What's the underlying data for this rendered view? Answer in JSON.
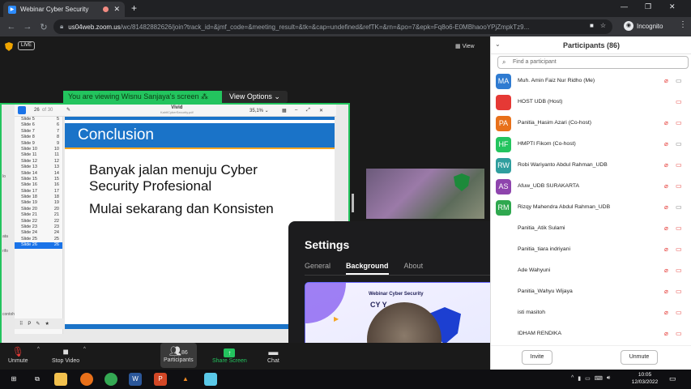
{
  "browser": {
    "tab_title": "Webinar Cyber Security",
    "url_host": "us04web.zoom.us",
    "url_path": "/wc/81482882626/join?track_id=&jmf_code=&meeting_result=&tk=&cap=undefined&refTK=&rn=&po=7&epk=Fq8o6-E0MBhaooYPjZmpkTz9...",
    "incognito_label": "Incognito"
  },
  "meeting": {
    "live_badge": "LIVE",
    "view_label": "View",
    "viewing_banner": "You are viewing Wisnu Sanjaya's screen",
    "view_options": "View Options"
  },
  "viewer": {
    "page_current": "26",
    "page_total": "of 30",
    "doc_title": "Vivid",
    "doc_subtitle": "KahfiCyberSecurity.pdf",
    "zoom_value": "35,1%",
    "slides": [
      {
        "label": "Slide 5",
        "num": "5"
      },
      {
        "label": "Slide 6",
        "num": "6"
      },
      {
        "label": "Slide 7",
        "num": "7"
      },
      {
        "label": "Slide 8",
        "num": "8"
      },
      {
        "label": "Slide 9",
        "num": "9"
      },
      {
        "label": "Slide 10",
        "num": "10"
      },
      {
        "label": "Slide 11",
        "num": "11"
      },
      {
        "label": "Slide 12",
        "num": "12"
      },
      {
        "label": "Slide 13",
        "num": "13"
      },
      {
        "label": "Slide 14",
        "num": "14"
      },
      {
        "label": "Slide 15",
        "num": "15"
      },
      {
        "label": "Slide 16",
        "num": "16"
      },
      {
        "label": "Slide 17",
        "num": "17"
      },
      {
        "label": "Slide 18",
        "num": "18"
      },
      {
        "label": "Slide 19",
        "num": "19"
      },
      {
        "label": "Slide 20",
        "num": "20"
      },
      {
        "label": "Slide 21",
        "num": "21"
      },
      {
        "label": "Slide 22",
        "num": "22"
      },
      {
        "label": "Slide 23",
        "num": "23"
      },
      {
        "label": "Slide 24",
        "num": "24"
      },
      {
        "label": "Slide 25",
        "num": "25"
      },
      {
        "label": "Slide 26",
        "num": "26"
      }
    ],
    "side_labels": [
      "lo",
      "ata",
      "rifo",
      "contoh"
    ],
    "bottom_names": [
      "Participants",
      "Portfolio",
      "HKCTOD"
    ]
  },
  "slide": {
    "heading": "Conclusion",
    "line1": "Banyak jalan menuju Cyber",
    "line2": "Security Profesional",
    "line3": "Mulai sekarang dan Konsisten"
  },
  "settings": {
    "title": "Settings",
    "tabs": [
      "General",
      "Background",
      "About"
    ],
    "active_tab": "Background",
    "preview_title": "Webinar Cyber Security",
    "preview_big": "CY        Y"
  },
  "toolbar": {
    "unmute": "Unmute",
    "stop_video": "Stop Video",
    "participants": "Participants",
    "participants_count": "86",
    "share_screen": "Share Screen",
    "chat": "Chat"
  },
  "participants": {
    "title": "Participants (86)",
    "search_placeholder": "Find a participant",
    "invite": "Invite",
    "unmute": "Unmute",
    "list": [
      {
        "initials": "MA",
        "color": "#2f7bd1",
        "name": "Muh. Amin Faiz Nur Ridho (Me)",
        "video": "on"
      },
      {
        "initials": "",
        "color": "#e53935",
        "name": "HOST UDB (Host)",
        "video": "off",
        "mic": "none"
      },
      {
        "initials": "PA",
        "color": "#e8701a",
        "name": "Panitia_Hasim Azari (Co-host)",
        "video": "off"
      },
      {
        "initials": "HF",
        "color": "#23c45e",
        "name": "HMPTI Fikom (Co-host)",
        "video": "on"
      },
      {
        "initials": "RW",
        "color": "#2f9e9e",
        "name": "Robi Wariyanto Abdul Rahman_UDB",
        "video": "off"
      },
      {
        "initials": "AS",
        "color": "#8e44ad",
        "name": "Afuw_UDB SURAKARTA",
        "video": "off"
      },
      {
        "initials": "RM",
        "color": "#2fa84f",
        "name": "Rizqy Mahendra Abdul Rahman_UDB",
        "video": "on"
      },
      {
        "initials": "",
        "color": "#ffffff",
        "name": "Panitia_Atik Sulami",
        "video": "off"
      },
      {
        "initials": "",
        "color": "#ffffff",
        "name": "Panitia_tiara indriyani",
        "video": "off"
      },
      {
        "initials": "",
        "color": "#ffffff",
        "name": "Ade Wahyuni",
        "video": "off"
      },
      {
        "initials": "",
        "color": "#ffffff",
        "name": "Panitia_Wahyu Wijaya",
        "video": "off"
      },
      {
        "initials": "",
        "color": "#ffffff",
        "name": "isti masitoh",
        "video": "off"
      },
      {
        "initials": "",
        "color": "#ffffff",
        "name": "IDHAM RENDIKA",
        "video": "off"
      }
    ]
  },
  "taskbar": {
    "time": "10:05",
    "date": "12/03/2022"
  }
}
